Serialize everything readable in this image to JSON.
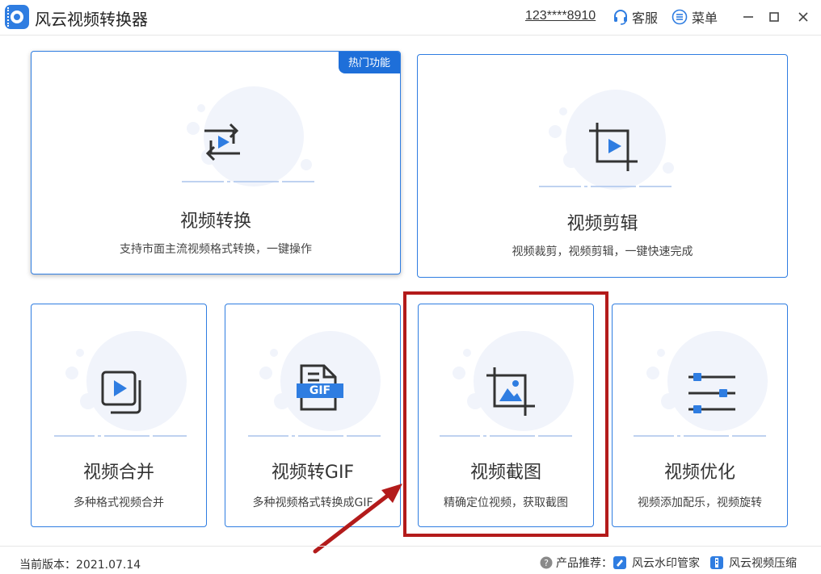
{
  "app": {
    "title": "风云视频转换器",
    "account": "123****8910",
    "service_label": "客服",
    "menu_label": "菜单"
  },
  "colors": {
    "accent": "#2f7de1",
    "badge": "#1e6fd9",
    "highlight": "#b31b1b"
  },
  "cards": [
    {
      "id": "convert",
      "title": "视频转换",
      "desc": "支持市面主流视频格式转换，一键操作",
      "badge": "热门功能",
      "icon": "convert-icon"
    },
    {
      "id": "edit",
      "title": "视频剪辑",
      "desc": "视频裁剪，视频剪辑，一键快速完成",
      "icon": "crop-play-icon"
    },
    {
      "id": "merge",
      "title": "视频合并",
      "desc": "多种格式视频合并",
      "icon": "merge-icon"
    },
    {
      "id": "gif",
      "title": "视频转GIF",
      "desc": "多种视频格式转换成GIF",
      "icon": "gif-file-icon",
      "icon_text": "GIF"
    },
    {
      "id": "screenshot",
      "title": "视频截图",
      "desc": "精确定位视频，获取截图",
      "icon": "crop-image-icon"
    },
    {
      "id": "optimize",
      "title": "视频优化",
      "desc": "视频添加配乐，视频旋转",
      "icon": "sliders-icon"
    }
  ],
  "footer": {
    "version": "当前版本：2021.07.14",
    "recommend_label": "产品推荐：",
    "products": [
      "风云水印管家",
      "风云视频压缩"
    ]
  }
}
